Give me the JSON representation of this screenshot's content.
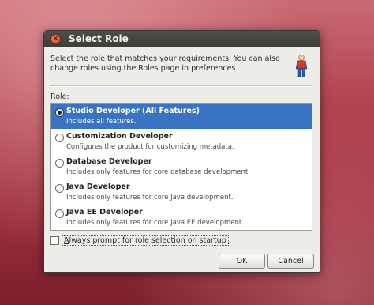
{
  "dialog": {
    "title": "Select Role",
    "description_line1": "Select the role that matches your requirements. You can also",
    "description_line2": "change roles using the Roles page in preferences.",
    "role_label_mnemonic": "R",
    "role_label_rest": "ole:",
    "roles": [
      {
        "title": "Studio Developer (All Features)",
        "desc": "Includes all features.",
        "selected": true
      },
      {
        "title": "Customization Developer",
        "desc": "Configures the product for customizing metadata.",
        "selected": false
      },
      {
        "title": "Database Developer",
        "desc": "Includes only features for core database development.",
        "selected": false
      },
      {
        "title": "Java Developer",
        "desc": "Includes only features for core Java development.",
        "selected": false
      },
      {
        "title": "Java EE Developer",
        "desc": "Includes only features for core Java EE development.",
        "selected": false
      }
    ],
    "checkbox_mnemonic": "A",
    "checkbox_rest": "lways prompt for role selection on startup",
    "checkbox_checked": false,
    "ok_label": "OK",
    "cancel_label": "Cancel"
  },
  "icons": {
    "close": "close-icon",
    "person": "person-icon"
  },
  "colors": {
    "selection": "#3a73c2",
    "titlebar": "#3d3c38",
    "dialog_bg": "#efedea",
    "close_button": "#d9542f"
  }
}
